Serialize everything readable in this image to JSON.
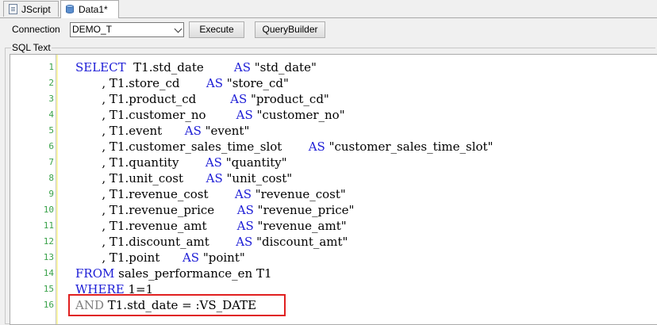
{
  "tabs": [
    {
      "label": "JScript",
      "icon": "document-icon"
    },
    {
      "label": "Data1*",
      "icon": "database-icon"
    }
  ],
  "toolbar": {
    "connection_label": "Connection",
    "connection_value": "DEMO_T",
    "execute_label": "Execute",
    "querybuilder_label": "QueryBuilder"
  },
  "editor": {
    "group_label": "SQL Text",
    "lines": [
      {
        "n": "1",
        "segments": [
          [
            "kw",
            "SELECT"
          ],
          [
            "t",
            "  T1.std_date        "
          ],
          [
            "kw",
            "AS"
          ],
          [
            "t",
            " \"std_date\""
          ]
        ]
      },
      {
        "n": "2",
        "segments": [
          [
            "t",
            "       , T1.store_cd       "
          ],
          [
            "kw",
            "AS"
          ],
          [
            "t",
            " \"store_cd\""
          ]
        ]
      },
      {
        "n": "3",
        "segments": [
          [
            "t",
            "       , T1.product_cd         "
          ],
          [
            "kw",
            "AS"
          ],
          [
            "t",
            " \"product_cd\""
          ]
        ]
      },
      {
        "n": "4",
        "segments": [
          [
            "t",
            "       , T1.customer_no        "
          ],
          [
            "kw",
            "AS"
          ],
          [
            "t",
            " \"customer_no\""
          ]
        ]
      },
      {
        "n": "5",
        "segments": [
          [
            "t",
            "       , T1.event      "
          ],
          [
            "kw",
            "AS"
          ],
          [
            "t",
            " \"event\""
          ]
        ]
      },
      {
        "n": "6",
        "segments": [
          [
            "t",
            "       , T1.customer_sales_time_slot       "
          ],
          [
            "kw",
            "AS"
          ],
          [
            "t",
            " \"customer_sales_time_slot\""
          ]
        ]
      },
      {
        "n": "7",
        "segments": [
          [
            "t",
            "       , T1.quantity       "
          ],
          [
            "kw",
            "AS"
          ],
          [
            "t",
            " \"quantity\""
          ]
        ]
      },
      {
        "n": "8",
        "segments": [
          [
            "t",
            "       , T1.unit_cost      "
          ],
          [
            "kw",
            "AS"
          ],
          [
            "t",
            " \"unit_cost\""
          ]
        ]
      },
      {
        "n": "9",
        "segments": [
          [
            "t",
            "       , T1.revenue_cost       "
          ],
          [
            "kw",
            "AS"
          ],
          [
            "t",
            " \"revenue_cost\""
          ]
        ]
      },
      {
        "n": "10",
        "segments": [
          [
            "t",
            "       , T1.revenue_price      "
          ],
          [
            "kw",
            "AS"
          ],
          [
            "t",
            " \"revenue_price\""
          ]
        ]
      },
      {
        "n": "11",
        "segments": [
          [
            "t",
            "       , T1.revenue_amt        "
          ],
          [
            "kw",
            "AS"
          ],
          [
            "t",
            " \"revenue_amt\""
          ]
        ]
      },
      {
        "n": "12",
        "segments": [
          [
            "t",
            "       , T1.discount_amt       "
          ],
          [
            "kw",
            "AS"
          ],
          [
            "t",
            " \"discount_amt\""
          ]
        ]
      },
      {
        "n": "13",
        "segments": [
          [
            "t",
            "       , T1.point      "
          ],
          [
            "kw",
            "AS"
          ],
          [
            "t",
            " \"point\""
          ]
        ]
      },
      {
        "n": "14",
        "segments": [
          [
            "kw",
            "FROM"
          ],
          [
            "t",
            " sales_performance_en T1"
          ]
        ]
      },
      {
        "n": "15",
        "segments": [
          [
            "kw",
            "WHERE"
          ],
          [
            "t",
            " 1=1"
          ]
        ]
      },
      {
        "n": "16",
        "segments": [
          [
            "kwg",
            "AND"
          ],
          [
            "t",
            " T1.std_date = :VS_DATE"
          ]
        ]
      }
    ]
  },
  "colors": {
    "keyword": "#1c1cd6",
    "line_number": "#3aa24a",
    "highlight": "#e02020"
  }
}
